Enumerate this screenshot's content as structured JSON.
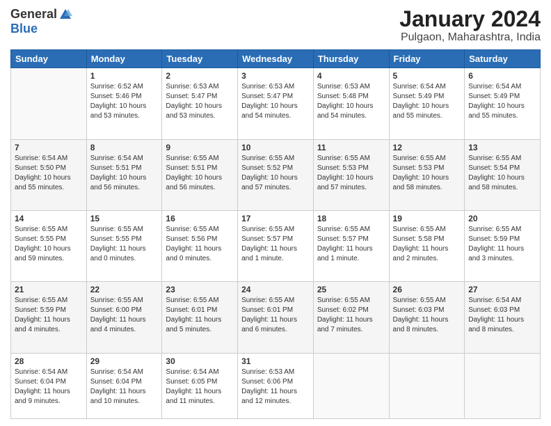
{
  "logo": {
    "general": "General",
    "blue": "Blue"
  },
  "header": {
    "title": "January 2024",
    "subtitle": "Pulgaon, Maharashtra, India"
  },
  "weekdays": [
    "Sunday",
    "Monday",
    "Tuesday",
    "Wednesday",
    "Thursday",
    "Friday",
    "Saturday"
  ],
  "weeks": [
    [
      {
        "day": "",
        "info": ""
      },
      {
        "day": "1",
        "info": "Sunrise: 6:52 AM\nSunset: 5:46 PM\nDaylight: 10 hours\nand 53 minutes."
      },
      {
        "day": "2",
        "info": "Sunrise: 6:53 AM\nSunset: 5:47 PM\nDaylight: 10 hours\nand 53 minutes."
      },
      {
        "day": "3",
        "info": "Sunrise: 6:53 AM\nSunset: 5:47 PM\nDaylight: 10 hours\nand 54 minutes."
      },
      {
        "day": "4",
        "info": "Sunrise: 6:53 AM\nSunset: 5:48 PM\nDaylight: 10 hours\nand 54 minutes."
      },
      {
        "day": "5",
        "info": "Sunrise: 6:54 AM\nSunset: 5:49 PM\nDaylight: 10 hours\nand 55 minutes."
      },
      {
        "day": "6",
        "info": "Sunrise: 6:54 AM\nSunset: 5:49 PM\nDaylight: 10 hours\nand 55 minutes."
      }
    ],
    [
      {
        "day": "7",
        "info": "Sunrise: 6:54 AM\nSunset: 5:50 PM\nDaylight: 10 hours\nand 55 minutes."
      },
      {
        "day": "8",
        "info": "Sunrise: 6:54 AM\nSunset: 5:51 PM\nDaylight: 10 hours\nand 56 minutes."
      },
      {
        "day": "9",
        "info": "Sunrise: 6:55 AM\nSunset: 5:51 PM\nDaylight: 10 hours\nand 56 minutes."
      },
      {
        "day": "10",
        "info": "Sunrise: 6:55 AM\nSunset: 5:52 PM\nDaylight: 10 hours\nand 57 minutes."
      },
      {
        "day": "11",
        "info": "Sunrise: 6:55 AM\nSunset: 5:53 PM\nDaylight: 10 hours\nand 57 minutes."
      },
      {
        "day": "12",
        "info": "Sunrise: 6:55 AM\nSunset: 5:53 PM\nDaylight: 10 hours\nand 58 minutes."
      },
      {
        "day": "13",
        "info": "Sunrise: 6:55 AM\nSunset: 5:54 PM\nDaylight: 10 hours\nand 58 minutes."
      }
    ],
    [
      {
        "day": "14",
        "info": "Sunrise: 6:55 AM\nSunset: 5:55 PM\nDaylight: 10 hours\nand 59 minutes."
      },
      {
        "day": "15",
        "info": "Sunrise: 6:55 AM\nSunset: 5:55 PM\nDaylight: 11 hours\nand 0 minutes."
      },
      {
        "day": "16",
        "info": "Sunrise: 6:55 AM\nSunset: 5:56 PM\nDaylight: 11 hours\nand 0 minutes."
      },
      {
        "day": "17",
        "info": "Sunrise: 6:55 AM\nSunset: 5:57 PM\nDaylight: 11 hours\nand 1 minute."
      },
      {
        "day": "18",
        "info": "Sunrise: 6:55 AM\nSunset: 5:57 PM\nDaylight: 11 hours\nand 1 minute."
      },
      {
        "day": "19",
        "info": "Sunrise: 6:55 AM\nSunset: 5:58 PM\nDaylight: 11 hours\nand 2 minutes."
      },
      {
        "day": "20",
        "info": "Sunrise: 6:55 AM\nSunset: 5:59 PM\nDaylight: 11 hours\nand 3 minutes."
      }
    ],
    [
      {
        "day": "21",
        "info": "Sunrise: 6:55 AM\nSunset: 5:59 PM\nDaylight: 11 hours\nand 4 minutes."
      },
      {
        "day": "22",
        "info": "Sunrise: 6:55 AM\nSunset: 6:00 PM\nDaylight: 11 hours\nand 4 minutes."
      },
      {
        "day": "23",
        "info": "Sunrise: 6:55 AM\nSunset: 6:01 PM\nDaylight: 11 hours\nand 5 minutes."
      },
      {
        "day": "24",
        "info": "Sunrise: 6:55 AM\nSunset: 6:01 PM\nDaylight: 11 hours\nand 6 minutes."
      },
      {
        "day": "25",
        "info": "Sunrise: 6:55 AM\nSunset: 6:02 PM\nDaylight: 11 hours\nand 7 minutes."
      },
      {
        "day": "26",
        "info": "Sunrise: 6:55 AM\nSunset: 6:03 PM\nDaylight: 11 hours\nand 8 minutes."
      },
      {
        "day": "27",
        "info": "Sunrise: 6:54 AM\nSunset: 6:03 PM\nDaylight: 11 hours\nand 8 minutes."
      }
    ],
    [
      {
        "day": "28",
        "info": "Sunrise: 6:54 AM\nSunset: 6:04 PM\nDaylight: 11 hours\nand 9 minutes."
      },
      {
        "day": "29",
        "info": "Sunrise: 6:54 AM\nSunset: 6:04 PM\nDaylight: 11 hours\nand 10 minutes."
      },
      {
        "day": "30",
        "info": "Sunrise: 6:54 AM\nSunset: 6:05 PM\nDaylight: 11 hours\nand 11 minutes."
      },
      {
        "day": "31",
        "info": "Sunrise: 6:53 AM\nSunset: 6:06 PM\nDaylight: 11 hours\nand 12 minutes."
      },
      {
        "day": "",
        "info": ""
      },
      {
        "day": "",
        "info": ""
      },
      {
        "day": "",
        "info": ""
      }
    ]
  ]
}
